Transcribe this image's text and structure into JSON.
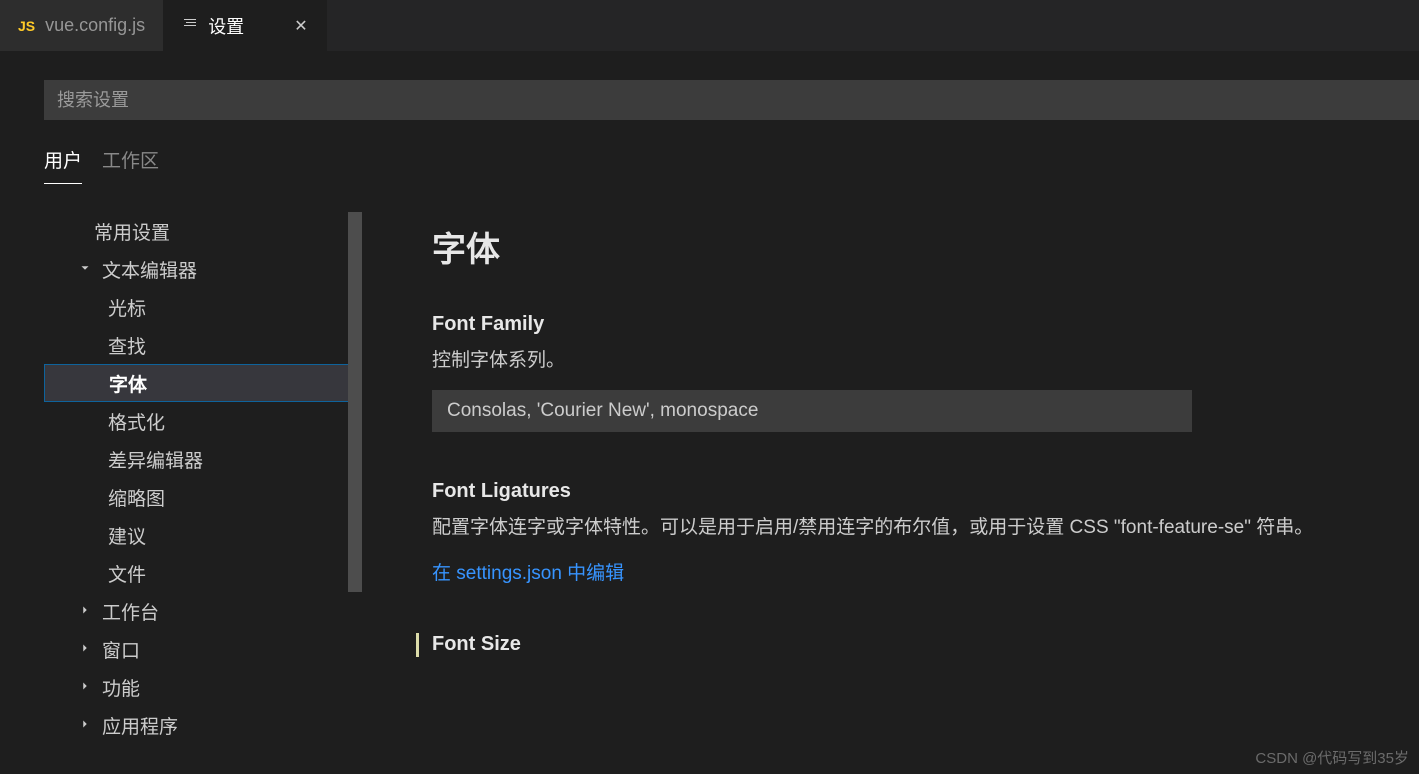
{
  "tabs": [
    {
      "icon": "JS",
      "label": "vue.config.js",
      "active": false
    },
    {
      "icon": "settings",
      "label": "设置",
      "active": true
    }
  ],
  "search": {
    "placeholder": "搜索设置"
  },
  "scope": {
    "user": "用户",
    "workspace": "工作区"
  },
  "sidebar": {
    "items": [
      {
        "label": "常用设置",
        "indent": 0
      },
      {
        "label": "文本编辑器",
        "indent": 1,
        "chevron": "down"
      },
      {
        "label": "光标",
        "indent": 2
      },
      {
        "label": "查找",
        "indent": 2
      },
      {
        "label": "字体",
        "indent": 2,
        "selected": true
      },
      {
        "label": "格式化",
        "indent": 2
      },
      {
        "label": "差异编辑器",
        "indent": 2
      },
      {
        "label": "缩略图",
        "indent": 2
      },
      {
        "label": "建议",
        "indent": 2
      },
      {
        "label": "文件",
        "indent": 2
      },
      {
        "label": "工作台",
        "indent": 1,
        "chevron": "right"
      },
      {
        "label": "窗口",
        "indent": 1,
        "chevron": "right"
      },
      {
        "label": "功能",
        "indent": 1,
        "chevron": "right"
      },
      {
        "label": "应用程序",
        "indent": 1,
        "chevron": "right"
      }
    ]
  },
  "main": {
    "heading": "字体",
    "fontFamily": {
      "title": "Font Family",
      "desc": "控制字体系列。",
      "value": "Consolas, 'Courier New', monospace"
    },
    "fontLigatures": {
      "title": "Font Ligatures",
      "desc": "配置字体连字或字体特性。可以是用于启用/禁用连字的布尔值，或用于设置 CSS \"font-feature-se\" 符串。",
      "link": "在 settings.json 中编辑"
    },
    "fontSize": {
      "title": "Font Size"
    }
  },
  "watermark": "CSDN @代码写到35岁"
}
